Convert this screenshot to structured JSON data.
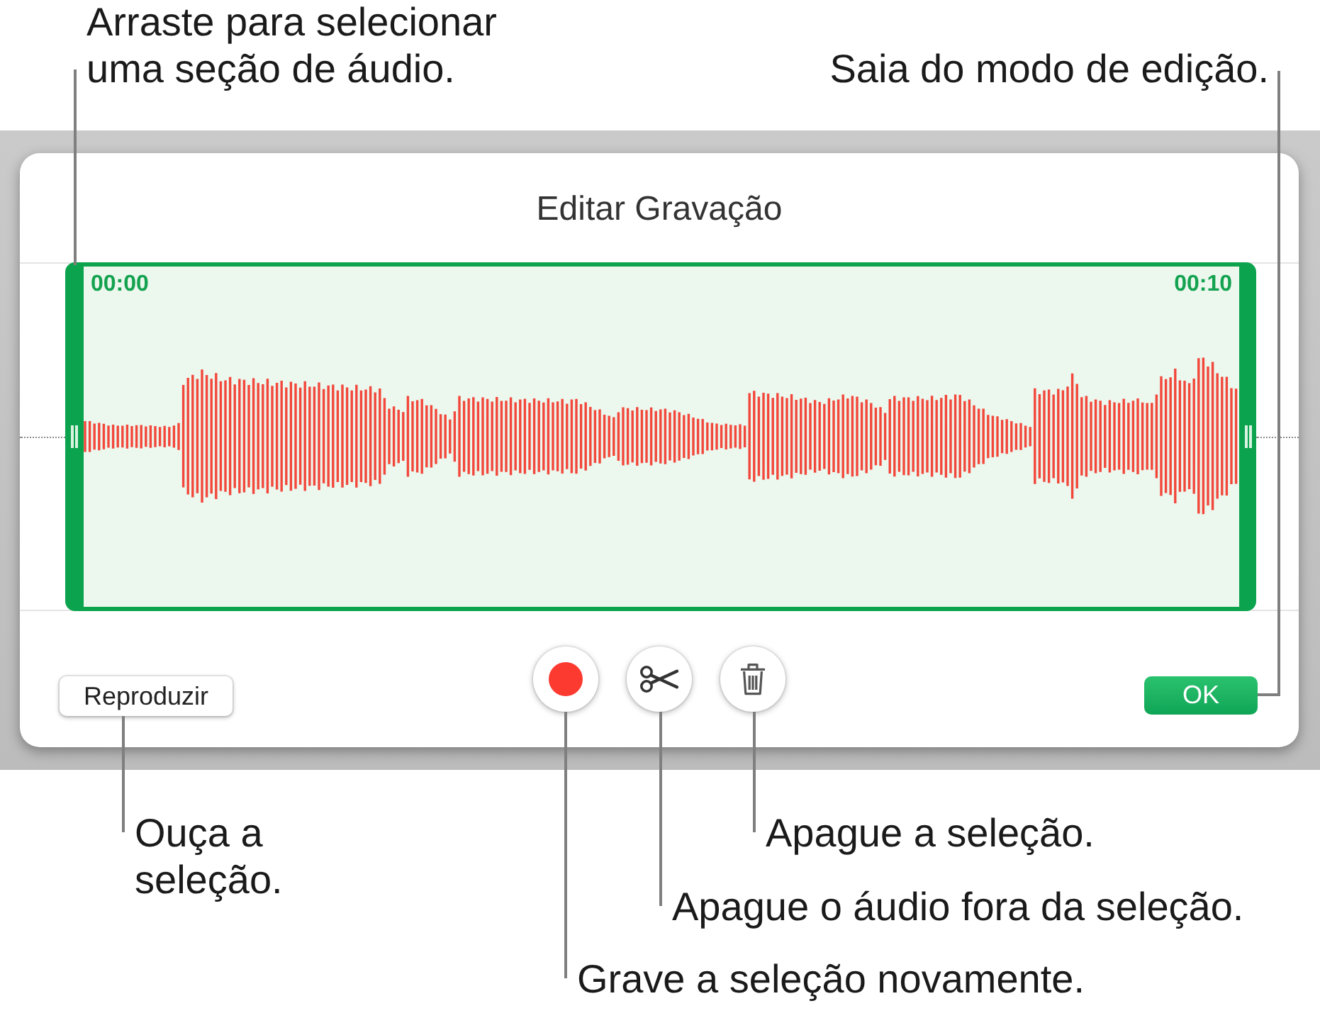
{
  "callouts_above": [
    "Arraste para selecionar uma seção de áudio.",
    "Saia do modo de edição."
  ],
  "dialog": {
    "title": "Editar Gravação",
    "selection": {
      "start_time": "00:00",
      "end_time": "00:10"
    },
    "controls": [
      {
        "kind": "play",
        "label": "Reproduzir"
      },
      {
        "kind": "record"
      },
      {
        "kind": "trim"
      },
      {
        "kind": "delete"
      },
      {
        "kind": "done",
        "label": "OK"
      }
    ]
  },
  "callouts_below": [
    "Ouça a seleção.",
    "Apague a seleção.",
    "Apague o áudio fora da seleção.",
    "Grave a seleção novamente."
  ]
}
